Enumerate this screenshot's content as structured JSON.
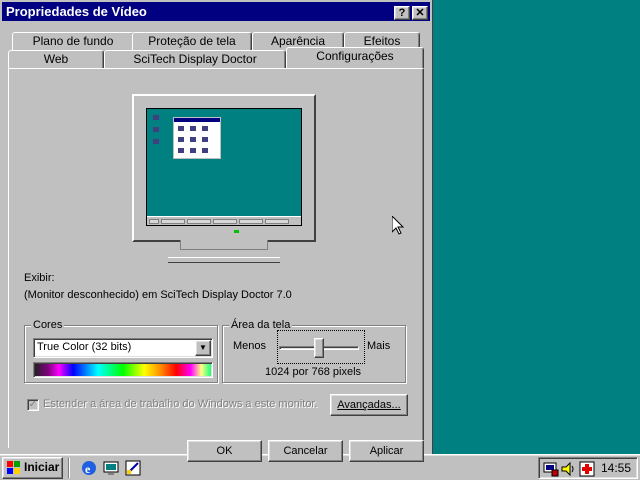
{
  "window": {
    "title": "Propriedades de Vídeo",
    "help_btn": "?",
    "close_btn": "✕"
  },
  "tabs": {
    "row1": [
      "Plano de fundo",
      "Proteção de tela",
      "Aparência",
      "Efeitos"
    ],
    "row2": [
      "Web",
      "SciTech Display Doctor",
      "Configurações"
    ],
    "active": "Configurações"
  },
  "display": {
    "exibir_label": "Exibir:",
    "monitor_text": "(Monitor desconhecido) em SciTech Display Doctor 7.0"
  },
  "colors_group": {
    "legend": "Cores",
    "selected": "True Color (32 bits)"
  },
  "area_group": {
    "legend": "Área da tela",
    "less": "Menos",
    "more": "Mais",
    "resolution": "1024 por 768 pixels",
    "slider_level": 0.5
  },
  "extend": {
    "label": "Estender a área de trabalho do Windows a este monitor."
  },
  "buttons": {
    "advanced": "Avançadas...",
    "ok": "OK",
    "cancel": "Cancelar",
    "apply": "Aplicar"
  },
  "taskbar": {
    "start": "Iniciar",
    "clock": "14:55"
  },
  "colors": {
    "desktop": "#008080",
    "titlebar": "#000080",
    "face": "#c0c0c0"
  }
}
